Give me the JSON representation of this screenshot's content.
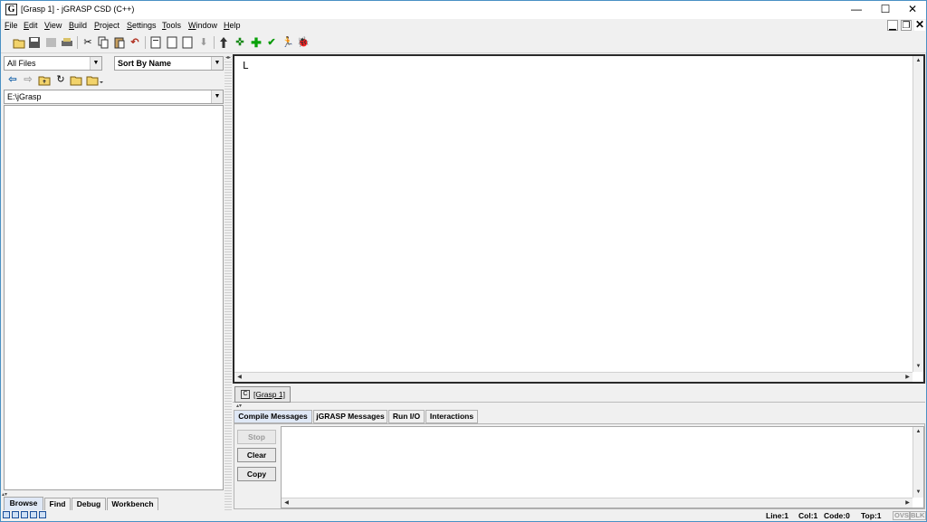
{
  "window": {
    "app_icon": "G",
    "title": "[Grasp 1] - jGRASP CSD (C++)",
    "minimize_glyph": "—",
    "maximize_glyph": "☐",
    "close_glyph": "✕"
  },
  "menubar": {
    "items": [
      "File",
      "Edit",
      "View",
      "Build",
      "Project",
      "Settings",
      "Tools",
      "Window",
      "Help"
    ]
  },
  "mdi_controls": [
    "▁",
    "❐",
    "✕"
  ],
  "toolbar": {
    "icons": [
      "open-icon",
      "save-icon",
      "save-all-icon",
      "print-icon",
      "cut-icon",
      "copy-icon",
      "paste-icon",
      "undo-icon",
      "new-file-icon",
      "new-file-2-icon",
      "new-file-3-icon",
      "pin-icon",
      "generate-csd-icon",
      "compile-icon",
      "add-icon",
      "check-icon",
      "run-icon",
      "debug-icon"
    ]
  },
  "browse": {
    "filter_value": "All Files",
    "sort_value": "Sort By Name",
    "path_value": "E:\\jGrasp",
    "nav_icons": [
      "back-icon",
      "forward-icon",
      "up-folder-icon",
      "refresh-icon",
      "folder-icon",
      "folder-menu-icon"
    ]
  },
  "left_tabs": [
    "Browse",
    "Find",
    "Debug",
    "Workbench"
  ],
  "editor": {
    "cursor_text": "L",
    "tab_icon": "C",
    "tab_label": "[Grasp 1]"
  },
  "message_tabs": [
    "Compile Messages",
    "jGRASP Messages",
    "Run I/O",
    "Interactions"
  ],
  "message_buttons": {
    "stop": "Stop",
    "clear": "Clear",
    "copy": "Copy"
  },
  "status": {
    "line": "Line:1",
    "col": "Col:1",
    "code": "Code:0",
    "top": "Top:1",
    "ovs": "OVS",
    "blk": "BLK"
  },
  "colors": {
    "window_border": "#4a90c4",
    "tab_active_bg": "#dfe8f6",
    "editor_border": "#2a2a2a"
  }
}
